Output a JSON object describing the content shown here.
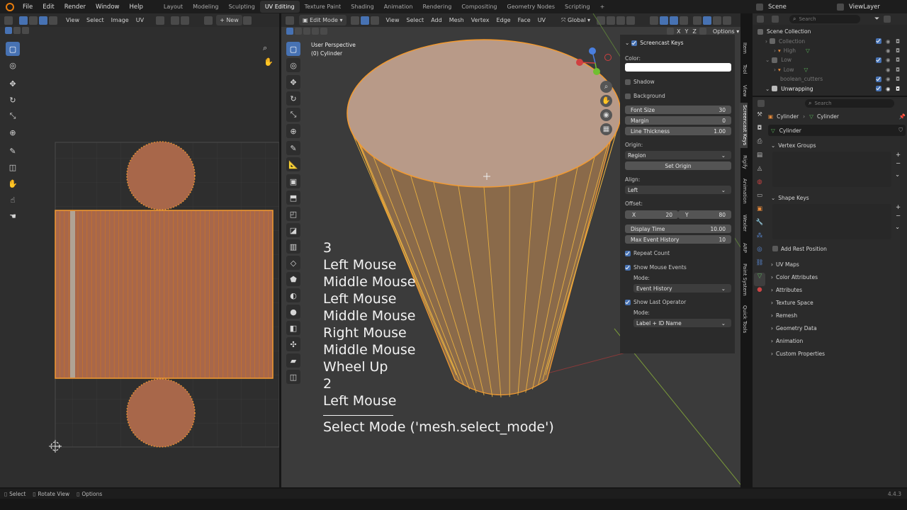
{
  "topbar": {
    "menus": [
      "File",
      "Edit",
      "Render",
      "Window",
      "Help"
    ],
    "workspaces": [
      "Layout",
      "Modeling",
      "Sculpting",
      "UV Editing",
      "Texture Paint",
      "Shading",
      "Animation",
      "Rendering",
      "Compositing",
      "Geometry Nodes",
      "Scripting"
    ],
    "active_workspace": "UV Editing",
    "add_tab": "+",
    "scene": "Scene",
    "view_layer": "ViewLayer"
  },
  "uv_editor": {
    "menus": [
      "View",
      "Select",
      "Image",
      "UV"
    ],
    "new_label": "New"
  },
  "viewport": {
    "mode": "Edit Mode",
    "menus": [
      "View",
      "Select",
      "Add",
      "Mesh",
      "Vertex",
      "Edge",
      "Face",
      "UV"
    ],
    "orientation": "Global",
    "options": "Options",
    "axes": [
      "X",
      "Y",
      "Z"
    ],
    "overlay_title": "User Perspective",
    "overlay_object": "(0) Cylinder"
  },
  "screencast": {
    "lines": [
      "3",
      "Left Mouse",
      "Middle Mouse",
      "Left Mouse",
      "Middle Mouse",
      "Right Mouse",
      "Middle Mouse",
      "Wheel Up",
      "2",
      "Left Mouse"
    ],
    "operator": "Select Mode ('mesh.select_mode')"
  },
  "npanel": {
    "header": "Screencast Keys",
    "color_label": "Color:",
    "shadow": "Shadow",
    "background": "Background",
    "font_size": {
      "label": "Font Size",
      "value": "30"
    },
    "margin": {
      "label": "Margin",
      "value": "0"
    },
    "line_thickness": {
      "label": "Line Thickness",
      "value": "1.00"
    },
    "origin_label": "Origin:",
    "origin_value": "Region",
    "set_origin": "Set Origin",
    "align_label": "Align:",
    "align_value": "Left",
    "offset_label": "Offset:",
    "offset_x_label": "X",
    "offset_x": "20",
    "offset_y_label": "Y",
    "offset_y": "80",
    "display_time": {
      "label": "Display Time",
      "value": "10.00"
    },
    "max_event_history": {
      "label": "Max Event History",
      "value": "10"
    },
    "repeat_count": "Repeat Count",
    "show_mouse_events": "Show Mouse Events",
    "mode_label": "Mode:",
    "mouse_mode_value": "Event History",
    "show_last_operator": "Show Last Operator",
    "operator_mode_label": "Mode:",
    "operator_mode_value": "Label + ID Name",
    "vtabs": [
      "Item",
      "Tool",
      "View",
      "Screencast Keys",
      "Rigify",
      "Animation",
      "Wexler",
      "ARP",
      "Paint System",
      "Quick Tools"
    ]
  },
  "outliner": {
    "search_placeholder": "Search",
    "rows": [
      {
        "name": "Scene Collection",
        "indent": 0
      },
      {
        "name": "Collection",
        "indent": 1
      },
      {
        "name": "High",
        "indent": 2
      },
      {
        "name": "Low",
        "indent": 1
      },
      {
        "name": "Low",
        "indent": 2
      },
      {
        "name": "boolean_cutters",
        "indent": 1
      },
      {
        "name": "Unwrapping",
        "indent": 1
      }
    ]
  },
  "properties": {
    "search_placeholder": "Search",
    "breadcrumb_object": "Cylinder",
    "breadcrumb_data": "Cylinder",
    "data_name": "Cylinder",
    "vertex_groups": "Vertex Groups",
    "shape_keys": "Shape Keys",
    "add_rest_position": "Add Rest Position",
    "panels": [
      "UV Maps",
      "Color Attributes",
      "Attributes",
      "Texture Space",
      "Remesh",
      "Geometry Data",
      "Animation",
      "Custom Properties"
    ]
  },
  "statusbar": {
    "items": [
      "Select",
      "Rotate View",
      "Options"
    ],
    "version": "4.4.3"
  },
  "colors": {
    "accent": "#4772b3",
    "selection_orange": "#f39a30",
    "mesh_face": "#a8674a"
  }
}
